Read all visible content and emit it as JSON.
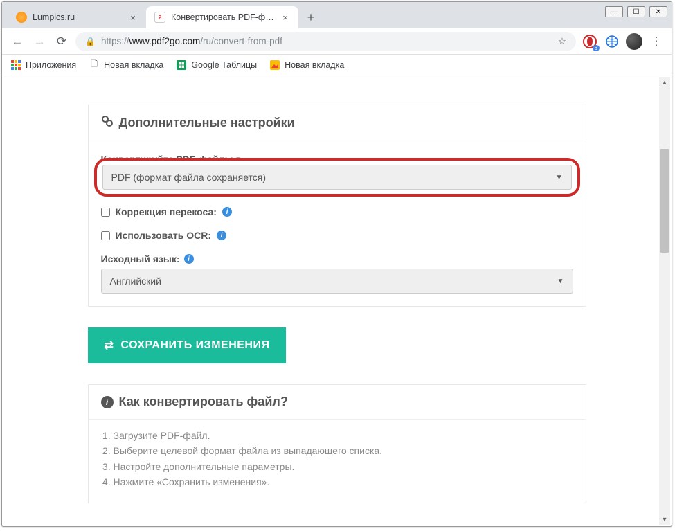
{
  "tabs": {
    "inactive": {
      "title": "Lumpics.ru"
    },
    "active": {
      "title": "Конвертировать PDF-файл — К"
    }
  },
  "url": {
    "scheme": "https://",
    "host": "www.pdf2go.com",
    "path": "/ru/convert-from-pdf"
  },
  "bookmarks": {
    "apps": "Приложения",
    "newtab1": "Новая вкладка",
    "sheets": "Google Таблицы",
    "newtab2": "Новая вкладка"
  },
  "ext_badge": "6",
  "settings_title": "Дополнительные настройки",
  "convert_label": "Конвертируйте PDF-файлы в:",
  "format_selected": "PDF (формат файла сохраняется)",
  "deskew_label": "Коррекция перекоса:",
  "ocr_label": "Использовать OCR:",
  "lang_label": "Исходный язык:",
  "lang_selected": "Английский",
  "save_btn": "СОХРАНИТЬ ИЗМЕНЕНИЯ",
  "help_title": "Как конвертировать файл?",
  "help_steps": {
    "0": "Загрузите PDF-файл.",
    "1": "Выберите целевой формат файла из выпадающего списка.",
    "2": "Настройте дополнительные параметры.",
    "3": "Нажмите «Сохранить изменения»."
  }
}
